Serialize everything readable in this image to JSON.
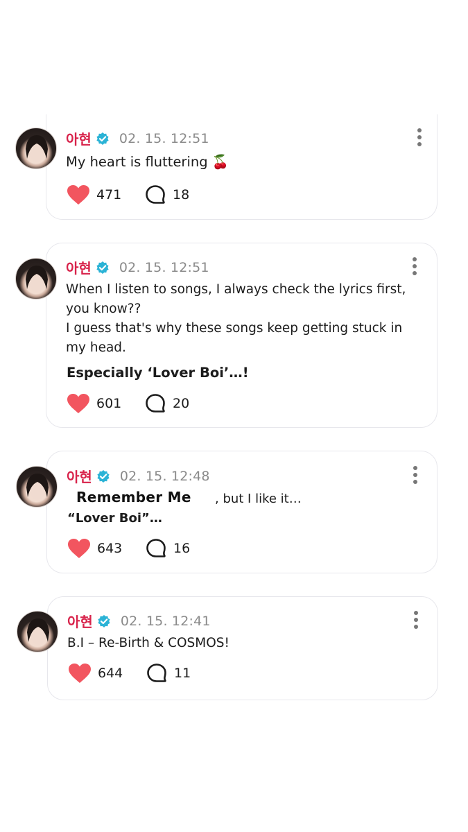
{
  "posts": [
    {
      "author": "아현",
      "date": "02. 15. 12:51",
      "text": "My heart is fluttering",
      "emoji": "🍒",
      "likes": "471",
      "comments": "18"
    },
    {
      "author": "아현",
      "date": "02. 15. 12:51",
      "line1": "When I listen to songs, I always check the lyrics first,",
      "line2": "you know??",
      "line3": "I guess that's why these songs keep getting stuck in",
      "line4": "my head.",
      "highlight": "Especially ‘Lover Boi’…!",
      "likes": "601",
      "comments": "20"
    },
    {
      "author": "아현",
      "date": "02. 15. 12:48",
      "sticker": "Remember Me",
      "line1": ", but I like it…",
      "line2": "“Lover Boi”…",
      "likes": "643",
      "comments": "16"
    },
    {
      "author": "아현",
      "date": "02. 15. 12:41",
      "text": "B.I – Re-Birth & COSMOS!",
      "likes": "644",
      "comments": "11"
    }
  ],
  "colors": {
    "name": "#d8234b",
    "verified": "#2bb3d6",
    "heart": "#f2555f",
    "date": "#8a8a8a"
  },
  "icons": {
    "verified": "verified-badge-icon",
    "like": "heart-icon",
    "comment": "comment-bubble-icon",
    "menu": "kebab-menu-icon"
  }
}
